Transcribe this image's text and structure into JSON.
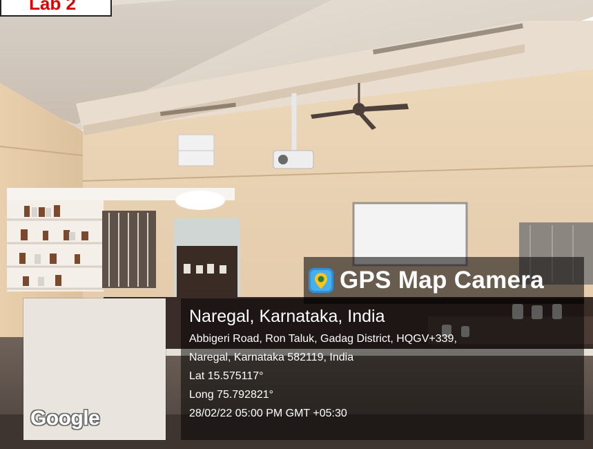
{
  "header_label": "Lab 2",
  "camera_brand": {
    "name": "GPS Map Camera",
    "icon": "map-pin-camera-icon"
  },
  "map": {
    "logo": "Google"
  },
  "location": {
    "title": "Naregal, Karnataka, India",
    "address_line1": "Abbigeri Road, Ron Taluk, Gadag District, HQGV+339,",
    "address_line2": "Naregal, Karnataka 582119, India",
    "latitude": "Lat 15.575117°",
    "longitude": "Long 75.792821°",
    "timestamp": "28/02/22 05:00 PM GMT +05:30"
  },
  "scene": [
    "ceiling fan",
    "projector",
    "whiteboard",
    "chemical shelves",
    "lab benches"
  ]
}
